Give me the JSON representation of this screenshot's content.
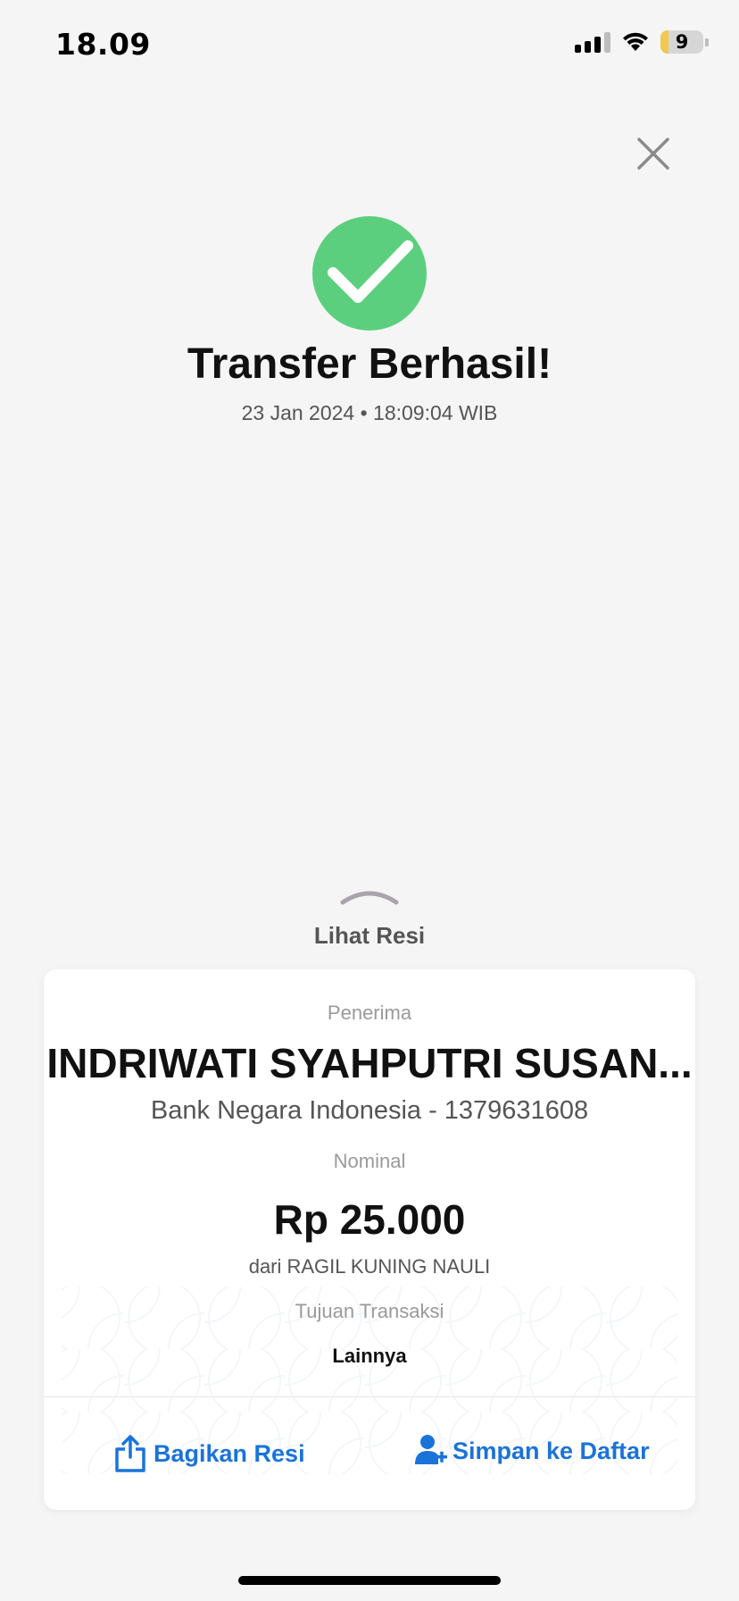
{
  "status_bar": {
    "time": "18.09",
    "battery_level": "9"
  },
  "header": {
    "close_icon": "close-icon"
  },
  "success": {
    "title": "Transfer Berhasil!",
    "datetime": "23 Jan 2024 • 18:09:04 WIB",
    "icon": "check-circle-icon",
    "icon_color": "#5ccf7e"
  },
  "receipt_toggle": {
    "label": "Lihat Resi"
  },
  "receipt": {
    "recipient_label": "Penerima",
    "recipient_name": "INDRIWATI SYAHPUTRI SUSAN...",
    "recipient_bank": "Bank Negara Indonesia - 1379631608",
    "amount_label": "Nominal",
    "amount": "Rp 25.000",
    "from": "dari RAGIL KUNING NAULI",
    "purpose_label": "Tujuan Transaksi",
    "purpose": "Lainnya"
  },
  "actions": {
    "share_label": "Bagikan Resi",
    "save_label": "Simpan ke Daftar",
    "accent_color": "#1a73d9"
  }
}
